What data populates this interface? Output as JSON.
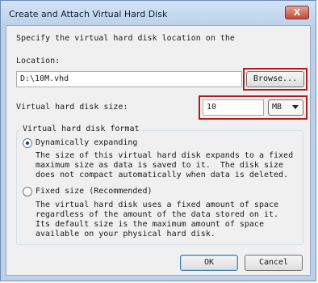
{
  "window": {
    "title": "Create and Attach Virtual Hard Disk",
    "close_label": "X"
  },
  "intro_text": "Specify the virtual hard disk location on the",
  "location": {
    "label": "Location:",
    "value": "D:\\10M.vhd",
    "browse_label": "Browse..."
  },
  "size": {
    "label": "Virtual hard disk size:",
    "value": "10",
    "unit_selected": "MB"
  },
  "format": {
    "legend": "Virtual hard disk format",
    "dynamic": {
      "label": "Dynamically expanding",
      "description": "The size of this virtual hard disk expands to a fixed\nmaximum size as data is saved to it.  The disk size\ndoes not compact automatically when data is deleted."
    },
    "fixed": {
      "label": "Fixed size (Recommended)",
      "description": "The virtual hard disk uses a fixed amount of space\nregardless of the amount of the data stored on it.\nIts default size is the maximum amount of space\navailable on your physical hard disk."
    }
  },
  "buttons": {
    "ok_label": "OK",
    "cancel_label": "Cancel"
  }
}
